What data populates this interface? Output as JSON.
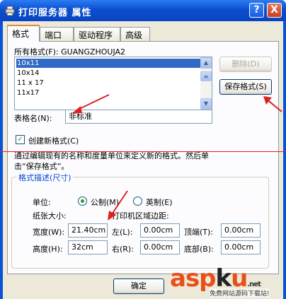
{
  "window": {
    "title": "打印服务器 属性",
    "help_button": "?",
    "close_button": "X"
  },
  "tabs": [
    {
      "label": "格式"
    },
    {
      "label": "端口"
    },
    {
      "label": "驱动程序"
    },
    {
      "label": "高级"
    }
  ],
  "all_formats_label": "所有格式(F): GUANGZHOUJA2",
  "format_list": [
    "10x11",
    "10x14",
    "11 x 17",
    "11x17"
  ],
  "delete_button": "删除(D)",
  "save_format_button": "保存格式(S)",
  "form_name_label": "表格名(N):",
  "form_name_value": "非标准",
  "create_new_label": "创建新格式(C)",
  "description": "通过编辑现有的名称和度量单位来定义新的格式。然后单击“保存格式”。",
  "group_title": "格式描述(尺寸)",
  "unit_label": "单位:",
  "metric_label": "公制(M)",
  "imperial_label": "英制(E)",
  "paper_size_label": "纸张大小:",
  "margin_label": "打印机区域边距:",
  "width_label": "宽度(W):",
  "width_value": "21.40cm",
  "height_label": "高度(H):",
  "height_value": "32cm",
  "left_label": "左(L):",
  "left_value": "0.00cm",
  "right_label": "右(R):",
  "right_value": "0.00cm",
  "top_label": "顶端(T):",
  "top_value": "0.00cm",
  "bottom_label": "底部(B):",
  "bottom_value": "0.00cm",
  "ok_button": "确定",
  "watermark": {
    "asp": "asp",
    "k": "k",
    "u": "u",
    "net": ".net",
    "sub": "免费网站源码下载站!"
  },
  "colors": {
    "title_bar": "#0a53d6",
    "selection": "#316ac5",
    "annotation": "#e02020",
    "watermark": "#e8501a"
  }
}
